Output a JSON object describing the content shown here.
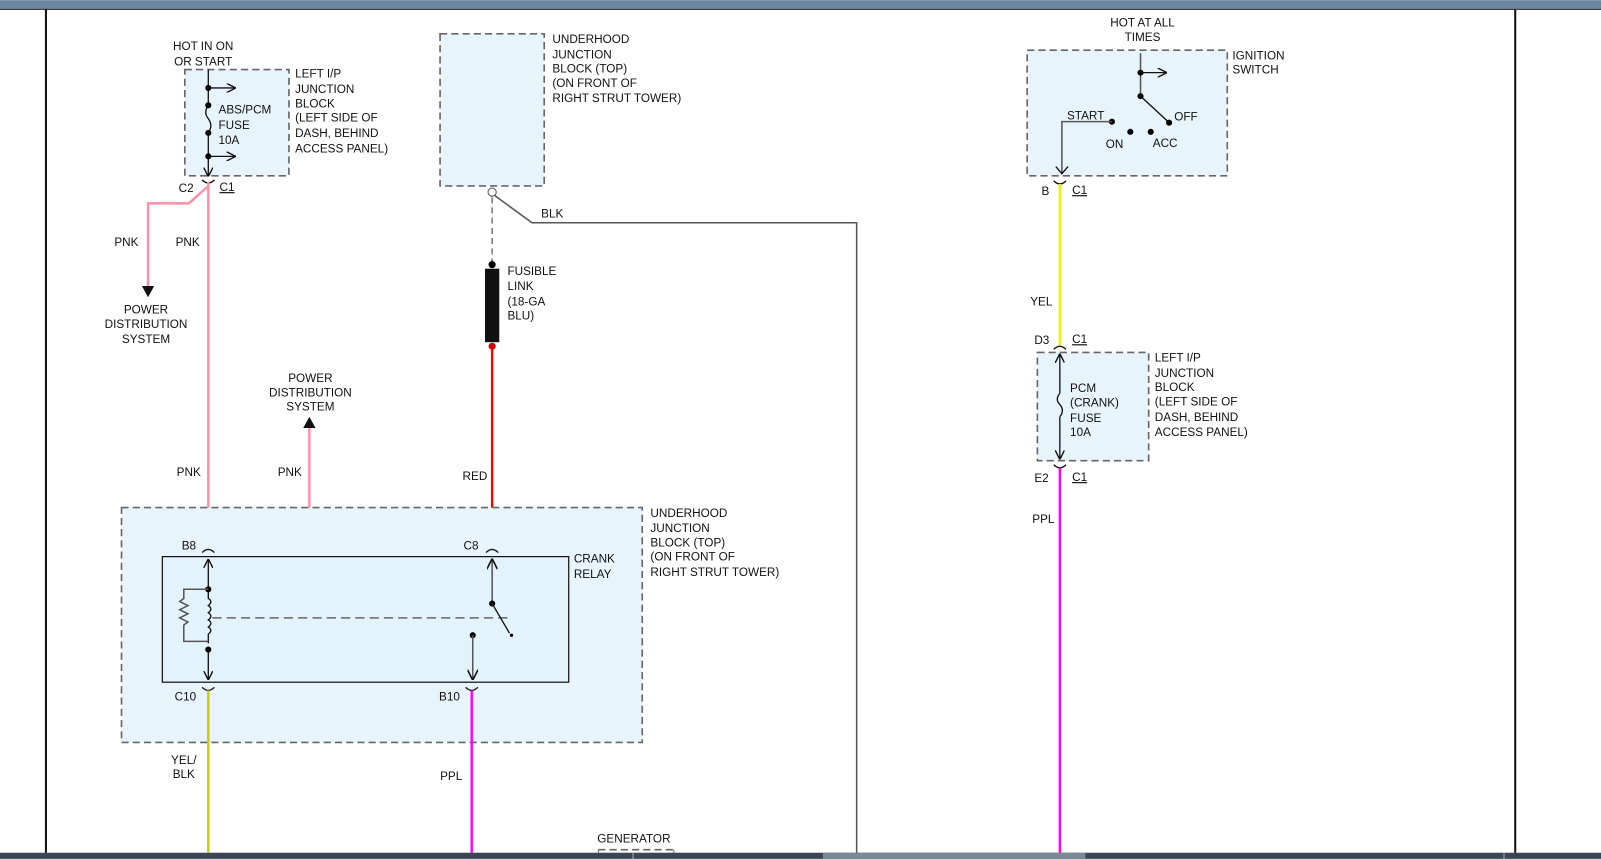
{
  "colors": {
    "pnk": "#ff8fa6",
    "red": "#ff0000",
    "yel": "#f2f200",
    "yel_blk": "#cccc00",
    "ppl": "#ff00ff",
    "blk": "#555555",
    "block_fill": "#e8f4fc",
    "topbar": "#6b86a0",
    "bottombar": "#3a4656",
    "scroll_thumb": "#7a8a94"
  },
  "left_ip_block": {
    "hot_label": [
      "HOT IN ON",
      "OR START"
    ],
    "fuse_label": [
      "ABS/PCM",
      "FUSE",
      "10A"
    ],
    "block_label": [
      "LEFT I/P",
      "JUNCTION",
      "BLOCK",
      "(LEFT SIDE OF",
      "DASH, BEHIND",
      "ACCESS PANEL)"
    ],
    "pin": "C2",
    "connector": "C1"
  },
  "pnk_branch": {
    "wire": "PNK",
    "wire2": "PNK",
    "dest": [
      "POWER",
      "DISTRIBUTION",
      "SYSTEM"
    ]
  },
  "pnk_branch2": {
    "wire": "PNK",
    "wire2": "PNK",
    "dest": [
      "POWER",
      "DISTRIBUTION",
      "SYSTEM"
    ]
  },
  "underhood_top": {
    "label": [
      "UNDERHOOD",
      "JUNCTION",
      "BLOCK (TOP)",
      "(ON FRONT OF",
      "RIGHT STRUT TOWER)"
    ],
    "blk_wire": "BLK"
  },
  "fusible_link": {
    "label": [
      "FUSIBLE",
      "LINK",
      "(18-GA",
      "BLU)"
    ],
    "wire": "RED"
  },
  "underhood_main": {
    "label": [
      "UNDERHOOD",
      "JUNCTION",
      "BLOCK (TOP)",
      "(ON FRONT OF",
      "RIGHT STRUT TOWER)"
    ],
    "relay_label": [
      "CRANK",
      "RELAY"
    ],
    "pins": {
      "b8": "B8",
      "c8": "C8",
      "c10": "C10",
      "b10": "B10"
    },
    "out_wire1": [
      "YEL/",
      "BLK"
    ],
    "out_wire2": "PPL"
  },
  "generator": "GENERATOR",
  "ignition": {
    "hot_label": [
      "HOT AT ALL",
      "TIMES"
    ],
    "label": [
      "IGNITION",
      "SWITCH"
    ],
    "positions": {
      "start": "START",
      "on": "ON",
      "acc": "ACC",
      "off": "OFF"
    },
    "pin": "B",
    "connector": "C1",
    "wire": "YEL"
  },
  "pcm_fuse_block": {
    "pin_in": "D3",
    "conn_in": "C1",
    "pin_out": "E2",
    "conn_out": "C1",
    "fuse_label": [
      "PCM",
      "(CRANK)",
      "FUSE",
      "10A"
    ],
    "block_label": [
      "LEFT I/P",
      "JUNCTION",
      "BLOCK",
      "(LEFT SIDE OF",
      "DASH, BEHIND",
      "ACCESS PANEL)"
    ],
    "out_wire": "PPL"
  }
}
